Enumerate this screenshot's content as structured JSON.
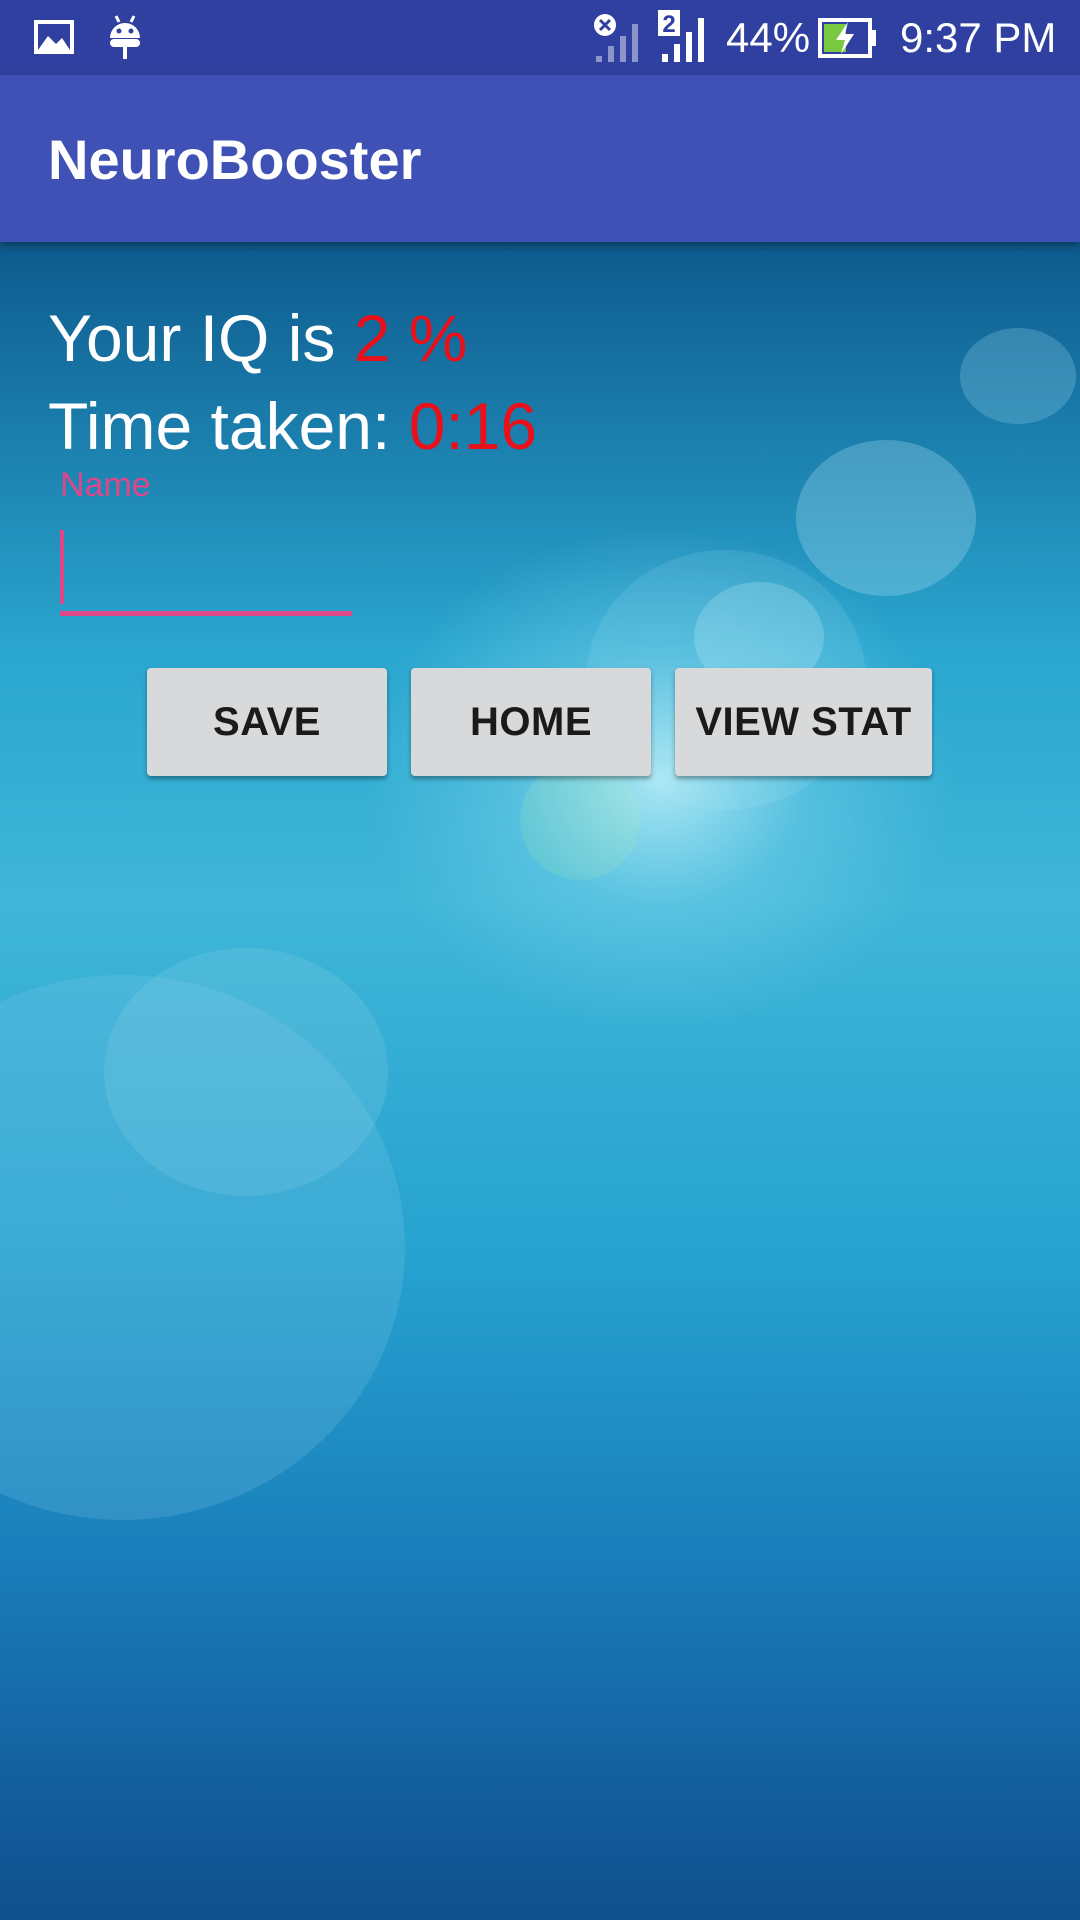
{
  "status_bar": {
    "battery_percent": "44%",
    "time": "9:37 PM",
    "sim2_label": "2",
    "icons": [
      "gallery-icon",
      "android-icon",
      "sim1-no-signal-icon",
      "sim2-signal-icon",
      "battery-charging-icon"
    ]
  },
  "app_bar": {
    "title": "NeuroBooster"
  },
  "result": {
    "iq_label": "Your IQ is ",
    "iq_value": "2 %",
    "time_label": "Time taken: ",
    "time_value": "0:16"
  },
  "name_field": {
    "label": "Name",
    "value": ""
  },
  "buttons": {
    "save": "SAVE",
    "home": "HOME",
    "view_stat": "VIEW STAT"
  },
  "colors": {
    "status_bar": "#3040a0",
    "app_bar": "#3f51b5",
    "accent": "#e0468a",
    "value_red": "#e8101a",
    "button": "#d7d9da"
  }
}
